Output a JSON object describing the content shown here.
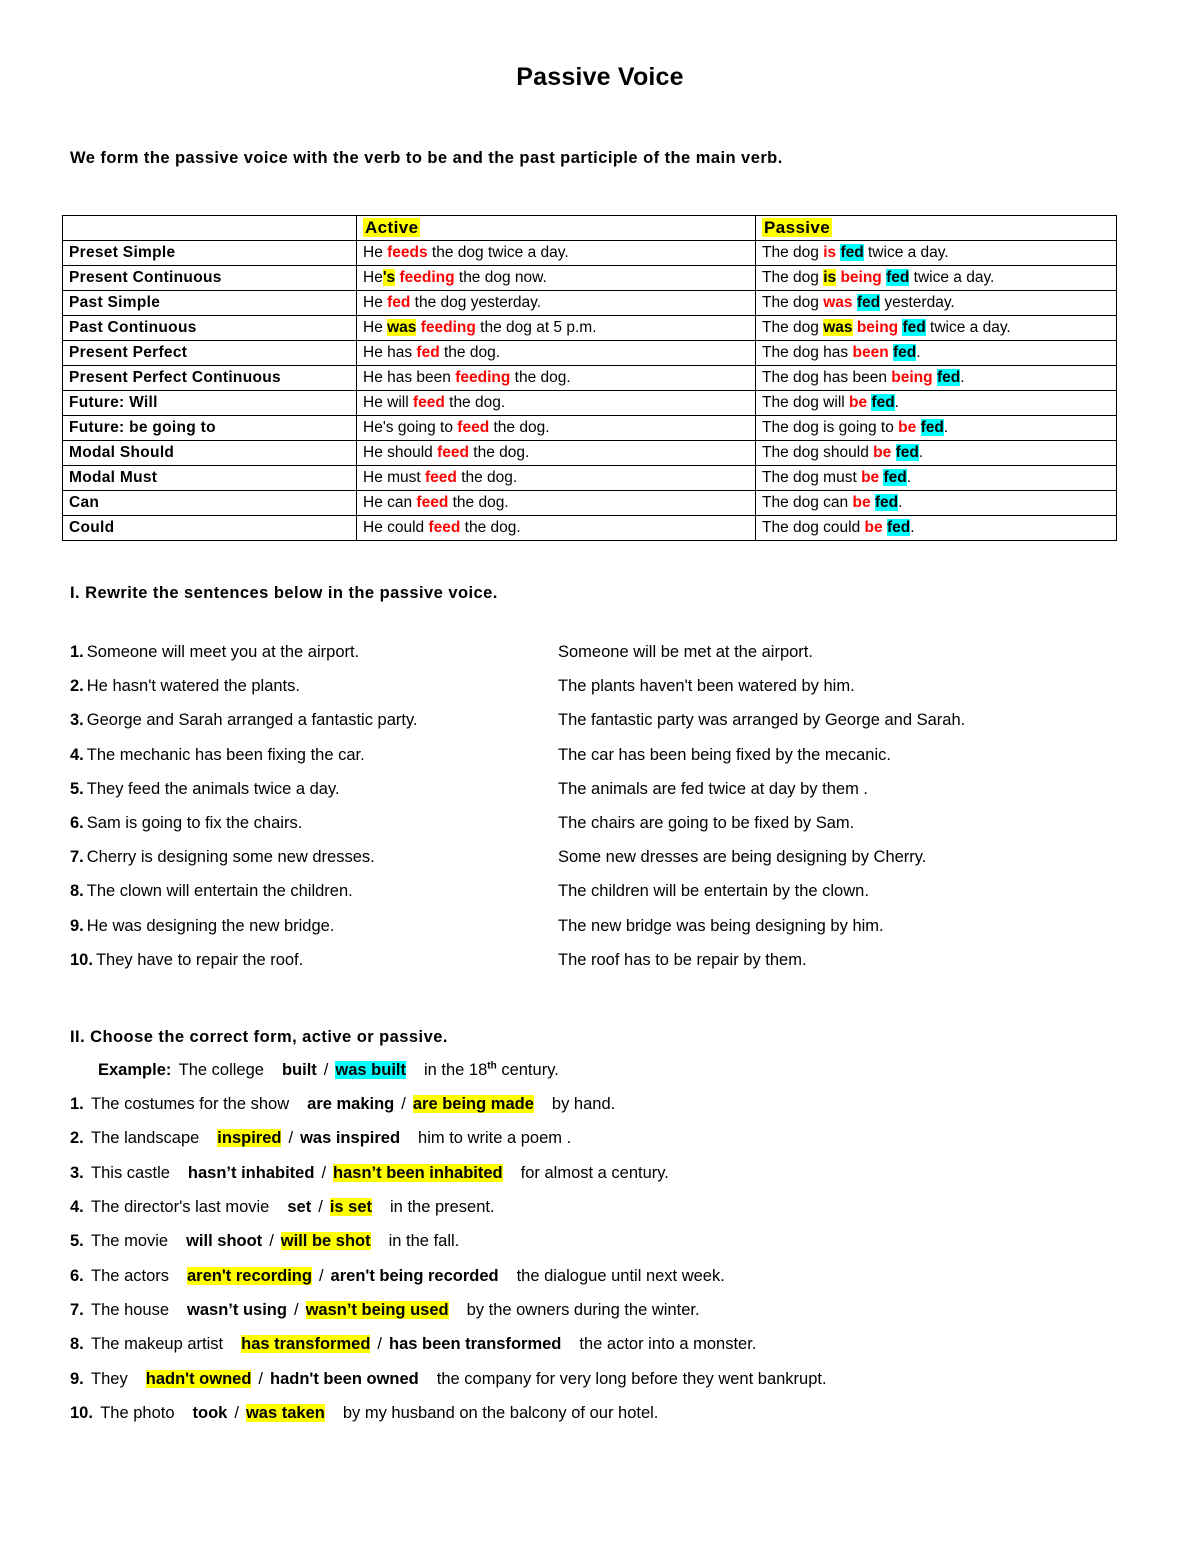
{
  "document": {
    "title": "Passive Voice",
    "intro": "We form the passive voice with the verb to be and the past participle of the main verb."
  },
  "tense_table": {
    "headers": {
      "blank": "",
      "active": "Active",
      "passive": "Passive"
    },
    "rows": [
      {
        "label": "Preset Simple",
        "active": [
          {
            "t": "He ",
            "s": "plain"
          },
          {
            "t": "feeds",
            "s": "red"
          },
          {
            "t": " the dog twice a day.",
            "s": "plain"
          }
        ],
        "passive": [
          {
            "t": "The dog ",
            "s": "plain"
          },
          {
            "t": "is",
            "s": "red"
          },
          {
            "t": " ",
            "s": "plain"
          },
          {
            "t": "fed",
            "s": "cyan"
          },
          {
            "t": " twice a day.",
            "s": "plain"
          }
        ]
      },
      {
        "label": "Present Continuous",
        "active": [
          {
            "t": "He",
            "s": "plain"
          },
          {
            "t": "'s",
            "s": "yellow"
          },
          {
            "t": " ",
            "s": "plain"
          },
          {
            "t": "feeding",
            "s": "red"
          },
          {
            "t": " the dog now.",
            "s": "plain"
          }
        ],
        "passive": [
          {
            "t": "The dog ",
            "s": "plain"
          },
          {
            "t": "is",
            "s": "yellow"
          },
          {
            "t": " ",
            "s": "plain"
          },
          {
            "t": "being",
            "s": "red"
          },
          {
            "t": " ",
            "s": "plain"
          },
          {
            "t": "fed",
            "s": "cyan"
          },
          {
            "t": " twice a day.",
            "s": "plain"
          }
        ]
      },
      {
        "label": "Past Simple",
        "active": [
          {
            "t": "He ",
            "s": "plain"
          },
          {
            "t": "fed",
            "s": "red"
          },
          {
            "t": " the dog yesterday.",
            "s": "plain"
          }
        ],
        "passive": [
          {
            "t": "The dog ",
            "s": "plain"
          },
          {
            "t": "was",
            "s": "red"
          },
          {
            "t": " ",
            "s": "plain"
          },
          {
            "t": "fed",
            "s": "cyan"
          },
          {
            "t": " yesterday.",
            "s": "plain"
          }
        ]
      },
      {
        "label": "Past Continuous",
        "active": [
          {
            "t": "He ",
            "s": "plain"
          },
          {
            "t": "was",
            "s": "yellow"
          },
          {
            "t": " ",
            "s": "plain"
          },
          {
            "t": "feeding",
            "s": "red"
          },
          {
            "t": " the dog at 5 p.m.",
            "s": "plain"
          }
        ],
        "passive": [
          {
            "t": "The dog ",
            "s": "plain"
          },
          {
            "t": "was",
            "s": "yellow"
          },
          {
            "t": " ",
            "s": "plain"
          },
          {
            "t": "being",
            "s": "red"
          },
          {
            "t": " ",
            "s": "plain"
          },
          {
            "t": "fed",
            "s": "cyan"
          },
          {
            "t": " twice a day.",
            "s": "plain"
          }
        ]
      },
      {
        "label": "Present Perfect",
        "active": [
          {
            "t": "He has ",
            "s": "plain"
          },
          {
            "t": "fed",
            "s": "red"
          },
          {
            "t": " the dog.",
            "s": "plain"
          }
        ],
        "passive": [
          {
            "t": "The dog has ",
            "s": "plain"
          },
          {
            "t": "been",
            "s": "red"
          },
          {
            "t": " ",
            "s": "plain"
          },
          {
            "t": "fed",
            "s": "cyan"
          },
          {
            "t": ".",
            "s": "plain"
          }
        ]
      },
      {
        "label": "Present Perfect Continuous",
        "active": [
          {
            "t": "He has been ",
            "s": "plain"
          },
          {
            "t": "feeding",
            "s": "red"
          },
          {
            "t": " the dog.",
            "s": "plain"
          }
        ],
        "passive": [
          {
            "t": "The dog has been ",
            "s": "plain"
          },
          {
            "t": "being",
            "s": "red"
          },
          {
            "t": " ",
            "s": "plain"
          },
          {
            "t": "fed",
            "s": "cyan"
          },
          {
            "t": ".",
            "s": "plain"
          }
        ]
      },
      {
        "label": "Future:  Will",
        "active": [
          {
            "t": "He will ",
            "s": "plain"
          },
          {
            "t": "feed",
            "s": "red"
          },
          {
            "t": " the dog.",
            "s": "plain"
          }
        ],
        "passive": [
          {
            "t": "The dog will ",
            "s": "plain"
          },
          {
            "t": "be",
            "s": "red"
          },
          {
            "t": " ",
            "s": "plain"
          },
          {
            "t": "fed",
            "s": "cyan"
          },
          {
            "t": ".",
            "s": "plain"
          }
        ]
      },
      {
        "label": "Future:   be going to",
        "active": [
          {
            "t": "He's going to ",
            "s": "plain"
          },
          {
            "t": "feed",
            "s": "red"
          },
          {
            "t": " the dog.",
            "s": "plain"
          }
        ],
        "passive": [
          {
            "t": "The dog is going to ",
            "s": "plain"
          },
          {
            "t": "be",
            "s": "red"
          },
          {
            "t": " ",
            "s": "plain"
          },
          {
            "t": "fed",
            "s": "cyan"
          },
          {
            "t": ".",
            "s": "plain"
          }
        ]
      },
      {
        "label": "Modal Should",
        "active": [
          {
            "t": "He should ",
            "s": "plain"
          },
          {
            "t": "feed",
            "s": "red"
          },
          {
            "t": " the dog.",
            "s": "plain"
          }
        ],
        "passive": [
          {
            "t": "The dog should ",
            "s": "plain"
          },
          {
            "t": "be",
            "s": "red"
          },
          {
            "t": " ",
            "s": "plain"
          },
          {
            "t": "fed",
            "s": "cyan"
          },
          {
            "t": ".",
            "s": "plain"
          }
        ]
      },
      {
        "label": "Modal Must",
        "active": [
          {
            "t": "He must ",
            "s": "plain"
          },
          {
            "t": "feed",
            "s": "red"
          },
          {
            "t": " the dog.",
            "s": "plain"
          }
        ],
        "passive": [
          {
            "t": "The dog must ",
            "s": "plain"
          },
          {
            "t": "be",
            "s": "red"
          },
          {
            "t": " ",
            "s": "plain"
          },
          {
            "t": "fed",
            "s": "cyan"
          },
          {
            "t": ".",
            "s": "plain"
          }
        ]
      },
      {
        "label": "Can",
        "active": [
          {
            "t": "He can ",
            "s": "plain"
          },
          {
            "t": "feed",
            "s": "red"
          },
          {
            "t": " the dog.",
            "s": "plain"
          }
        ],
        "passive": [
          {
            "t": "The dog can ",
            "s": "plain"
          },
          {
            "t": "be",
            "s": "red"
          },
          {
            "t": " ",
            "s": "plain"
          },
          {
            "t": "fed",
            "s": "cyan"
          },
          {
            "t": ".",
            "s": "plain"
          }
        ]
      },
      {
        "label": "Could",
        "active": [
          {
            "t": "He could ",
            "s": "plain"
          },
          {
            "t": "feed",
            "s": "red"
          },
          {
            "t": " the dog.",
            "s": "plain"
          }
        ],
        "passive": [
          {
            "t": "The dog could ",
            "s": "plain"
          },
          {
            "t": "be",
            "s": "red"
          },
          {
            "t": " ",
            "s": "plain"
          },
          {
            "t": "fed",
            "s": "cyan"
          },
          {
            "t": ".",
            "s": "plain"
          }
        ]
      }
    ]
  },
  "exercise1": {
    "heading": "I. Rewrite the sentences below in the passive voice.",
    "items": [
      {
        "num": "1.",
        "active": "Someone will meet you at the airport.",
        "answer": "Someone will be met at the airport."
      },
      {
        "num": "2.",
        "active": "He hasn't watered the plants.",
        "answer": "The plants haven't been watered by him."
      },
      {
        "num": "3.",
        "active": "George and Sarah arranged a fantastic party.",
        "answer": "The fantastic party was arranged by George and Sarah."
      },
      {
        "num": "4.",
        "active": "The mechanic has been fixing the car.",
        "answer": "The car has been being fixed by the mecanic."
      },
      {
        "num": "5.",
        "active": "They feed the animals twice a day.",
        "answer": "The animals are fed twice at day by them ."
      },
      {
        "num": "6.",
        "active": "Sam is going to fix the chairs.",
        "answer": "The chairs are going to be fixed by Sam."
      },
      {
        "num": "7.",
        "active": "Cherry is designing some new dresses.",
        "answer": "Some new dresses are being designing by Cherry."
      },
      {
        "num": "8.",
        "active": "The clown will entertain the children.",
        "answer": "The children will be entertain by the clown."
      },
      {
        "num": "9.",
        "active": "He was designing the new bridge.",
        "answer": "The new bridge was being designing by him."
      },
      {
        "num": "10.",
        "active": "They have to repair the roof.",
        "answer": "The roof has to be repair by them."
      }
    ]
  },
  "exercise2": {
    "heading": "II. Choose the correct form, active or passive.",
    "example": {
      "label": "Example:",
      "before": "The college",
      "option1": "built",
      "separator": "/",
      "option2": "was built",
      "after": "in the 18",
      "ordinal": "th",
      "after2": " century.",
      "highlight": "option2",
      "highlight_color": "cyan"
    },
    "items": [
      {
        "num": "1.",
        "before": "The costumes for the show",
        "option1": "are making",
        "separator": "/",
        "option2": "are being made",
        "after": "by hand.",
        "highlight": "option2"
      },
      {
        "num": "2.",
        "before": "The landscape",
        "option1": "inspired",
        "separator": "/",
        "option2": "was inspired",
        "after": "him to write a poem .",
        "highlight": "option1"
      },
      {
        "num": "3.",
        "before": "This castle",
        "option1": "hasn’t inhabited",
        "separator": "/",
        "option2": "hasn’t been inhabited",
        "after": "for almost a century.",
        "highlight": "option2"
      },
      {
        "num": "4.",
        "before": "The director's last movie",
        "option1": "set",
        "separator": "/",
        "option2": "is set",
        "after": "in the present.",
        "highlight": "option2"
      },
      {
        "num": "5.",
        "before": "The movie",
        "option1": "will shoot",
        "separator": "/",
        "option2": "will be shot",
        "after": "in the fall.",
        "highlight": "option2"
      },
      {
        "num": "6.",
        "before": "The actors",
        "option1": "aren't recording",
        "separator": "/",
        "option2": "aren't being recorded",
        "after": "the dialogue until next week.",
        "highlight": "option1"
      },
      {
        "num": "7.",
        "before": "The house",
        "option1": "wasn’t using",
        "separator": "/",
        "option2": "wasn’t being used",
        "after": "by the owners during the winter.",
        "highlight": "option2"
      },
      {
        "num": "8.",
        "before": "The makeup artist",
        "option1": "has transformed",
        "separator": "/",
        "option2": "has been transformed",
        "after": "the actor into a monster.",
        "highlight": "option1"
      },
      {
        "num": "9.",
        "before": "They",
        "option1": "hadn't owned",
        "separator": "/",
        "option2": "hadn't been owned",
        "after": "the company for very long before they went bankrupt.",
        "highlight": "option1"
      },
      {
        "num": "10.",
        "before": "The photo",
        "option1": "took",
        "separator": "/",
        "option2": "was taken",
        "after": "by my husband on the balcony of our hotel.",
        "highlight": "option2"
      }
    ]
  },
  "colors": {
    "highlight_yellow": "#ffff00",
    "highlight_cyan": "#00ffff",
    "emphasis_red": "#ff0000",
    "text": "#000000",
    "background": "#ffffff"
  }
}
